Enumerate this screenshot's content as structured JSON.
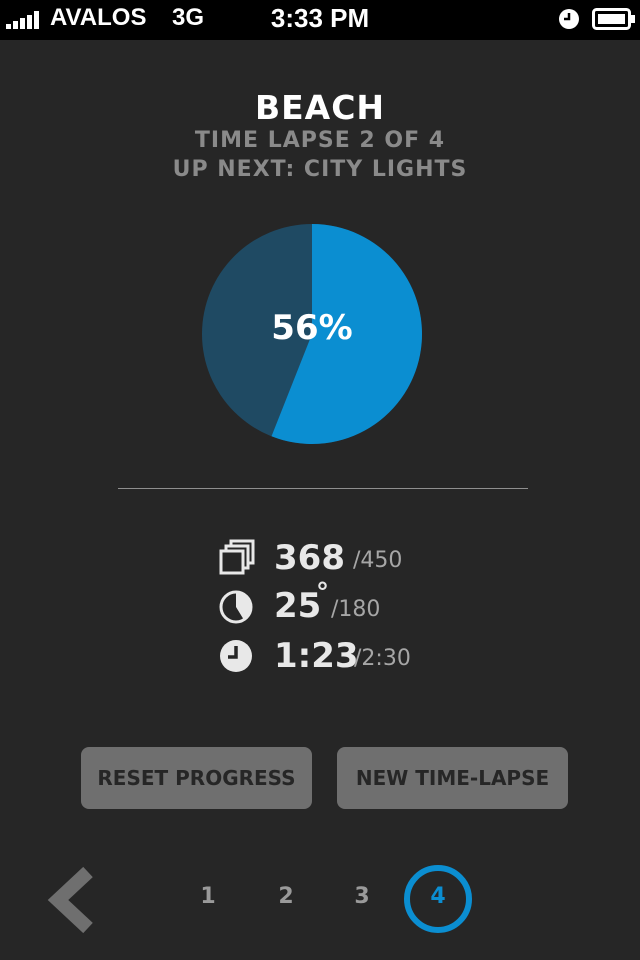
{
  "status_bar": {
    "carrier": "AVALOS",
    "network": "3G",
    "time": "3:33 PM",
    "signal_bars": 5,
    "icons": [
      "alarm-icon",
      "battery-icon"
    ]
  },
  "header": {
    "title": "BEACH",
    "progress_line": "TIME LAPSE 2 OF 4",
    "next_line": "UP NEXT: CITY LIGHTS"
  },
  "progress": {
    "percent_label": "56%",
    "fraction": 0.56,
    "fill_color": "#0b8ed1",
    "track_color": "#1f4a63"
  },
  "stats": [
    {
      "icon": "frames-icon",
      "value": "368",
      "total": "/450"
    },
    {
      "icon": "rotation-icon",
      "value": "25",
      "unit": "°",
      "total": "/180"
    },
    {
      "icon": "clock-icon",
      "value": "1:23",
      "total": "/2:30"
    }
  ],
  "buttons": {
    "reset": "RESET PROGRESS",
    "new": "NEW TIME-LAPSE"
  },
  "pagination": {
    "pages": [
      "1",
      "2",
      "3",
      "4"
    ],
    "active": "4",
    "back_icon": "chevron-left-icon"
  },
  "colors": {
    "accent": "#0b8ed1",
    "background": "#262626"
  }
}
